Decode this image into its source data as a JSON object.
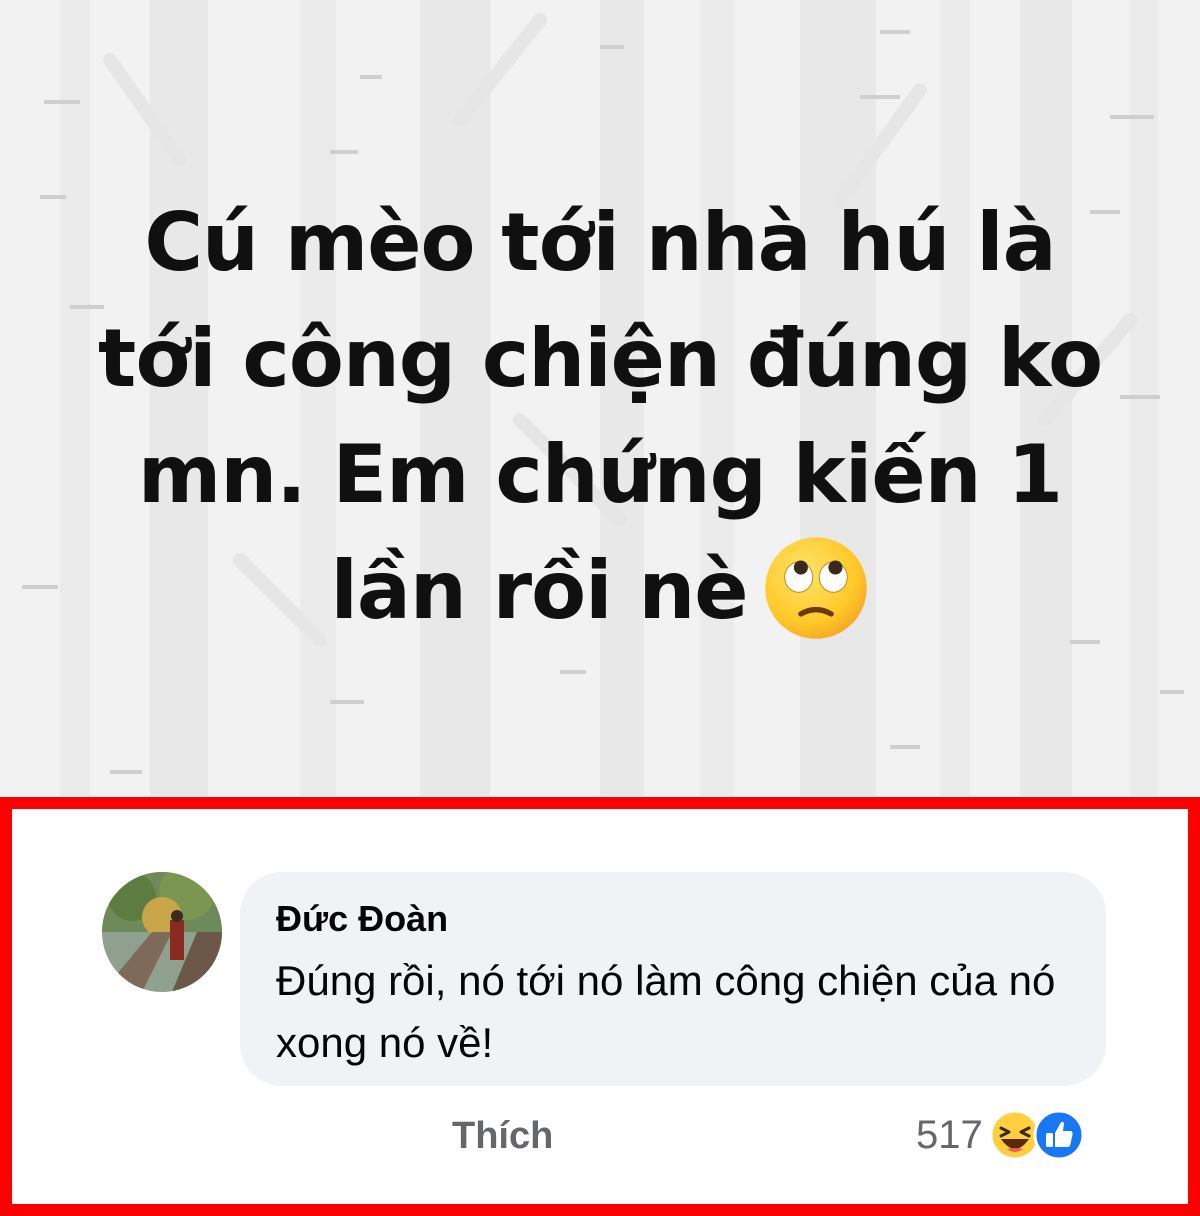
{
  "post": {
    "line1": "Cú mèo tới nhà hú là",
    "line2": "tới công chiện đúng ko",
    "line3": "mn. Em chứng kiến 1",
    "line4": "lần rồi nè",
    "emoji": "face-with-rolling-eyes-icon",
    "background_color": "#f2f2f2",
    "text_color": "#101010"
  },
  "comment": {
    "author": "Đức Đoàn",
    "text": "Đúng rồi, nó tới nó làm công chiện của nó xong nó về!",
    "like_label": "Thích",
    "reaction_count": "517",
    "reaction_icons": [
      "haha-icon",
      "like-icon"
    ],
    "bubble_color": "#f0f2f5",
    "highlight_border_color": "#ff0000",
    "like_color": "#1877f2"
  }
}
